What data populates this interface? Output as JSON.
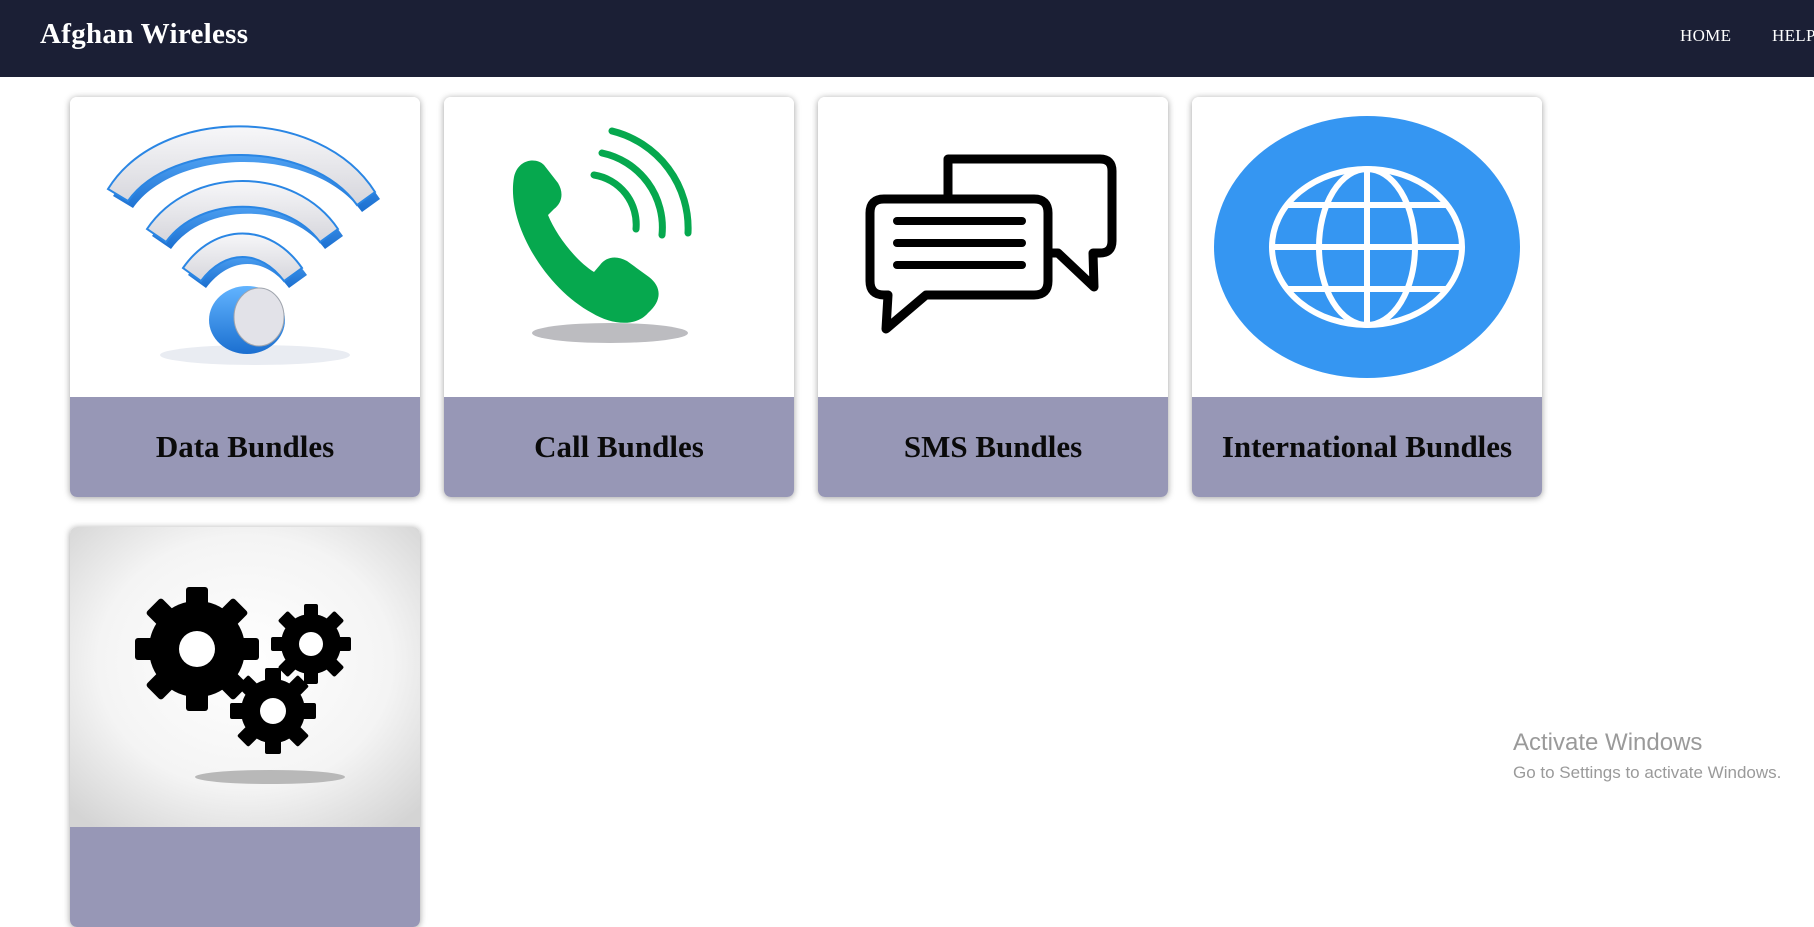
{
  "navbar": {
    "brand": "Afghan Wireless",
    "links": [
      "HOME",
      "HELP"
    ]
  },
  "cards": [
    {
      "label": "Data Bundles",
      "icon": "wifi-icon"
    },
    {
      "label": "Call Bundles",
      "icon": "phone-icon"
    },
    {
      "label": "SMS Bundles",
      "icon": "chat-bubbles-icon"
    },
    {
      "label": "International Bundles",
      "icon": "globe-icon"
    },
    {
      "label": "",
      "icon": "gears-icon"
    }
  ],
  "watermark": {
    "title": "Activate Windows",
    "subtitle": "Go to Settings to activate Windows."
  },
  "colors": {
    "navbar": "#1b1f35",
    "card_label_bar": "#9797b6",
    "globe_blue": "#3596f2",
    "phone_green": "#06a84e",
    "wifi_blue": "#2f8de4"
  }
}
